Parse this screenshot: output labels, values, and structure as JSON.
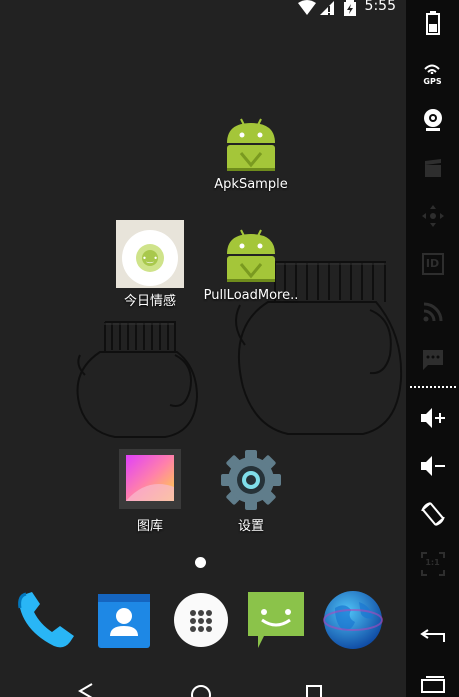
{
  "status_bar": {
    "time": "5:55",
    "icons": [
      "wifi-icon",
      "signal-no-data-icon",
      "battery-charging-icon"
    ]
  },
  "home": {
    "apps": [
      {
        "label": "ApkSample",
        "icon": "android-robot-icon"
      },
      {
        "label": "今日情感",
        "icon": "emotion-app-icon"
      },
      {
        "label": "PullLoadMore..",
        "icon": "android-robot-icon"
      },
      {
        "label": "图库",
        "icon": "gallery-icon"
      },
      {
        "label": "设置",
        "icon": "settings-gear-icon"
      }
    ],
    "page_count": 1,
    "current_page": 1
  },
  "dock": {
    "apps": [
      "phone-icon",
      "contacts-icon",
      "app-drawer-icon",
      "messaging-icon",
      "browser-globe-icon"
    ]
  },
  "nav_bar": {
    "buttons": [
      "back-icon",
      "home-icon",
      "recents-icon"
    ]
  },
  "emulator_panel": {
    "tools": [
      {
        "name": "battery",
        "icon": "battery-icon",
        "label": ""
      },
      {
        "name": "gps",
        "icon": "gps-icon",
        "label": "GPS"
      },
      {
        "name": "camera",
        "icon": "webcam-icon",
        "label": ""
      },
      {
        "name": "screencast",
        "icon": "clapperboard-icon",
        "label": ""
      },
      {
        "name": "dpad",
        "icon": "dpad-icon",
        "label": ""
      },
      {
        "name": "identifiers",
        "icon": "id-icon",
        "label": "ID"
      },
      {
        "name": "network",
        "icon": "rss-icon",
        "label": ""
      },
      {
        "name": "sms",
        "icon": "message-icon",
        "label": ""
      },
      {
        "name": "volume-up",
        "icon": "volume-up-icon",
        "label": ""
      },
      {
        "name": "volume-down",
        "icon": "volume-down-icon",
        "label": ""
      },
      {
        "name": "rotate",
        "icon": "rotate-icon",
        "label": ""
      },
      {
        "name": "pixel-perfect",
        "icon": "scale-1-1-icon",
        "label": "1:1"
      },
      {
        "name": "back",
        "icon": "back-arrow-icon",
        "label": ""
      },
      {
        "name": "home",
        "icon": "home-rect-icon",
        "label": ""
      }
    ]
  },
  "colors": {
    "android_green": "#a4c639",
    "screen_bg": "#222222",
    "panel_bg": "#0c0c0c"
  }
}
